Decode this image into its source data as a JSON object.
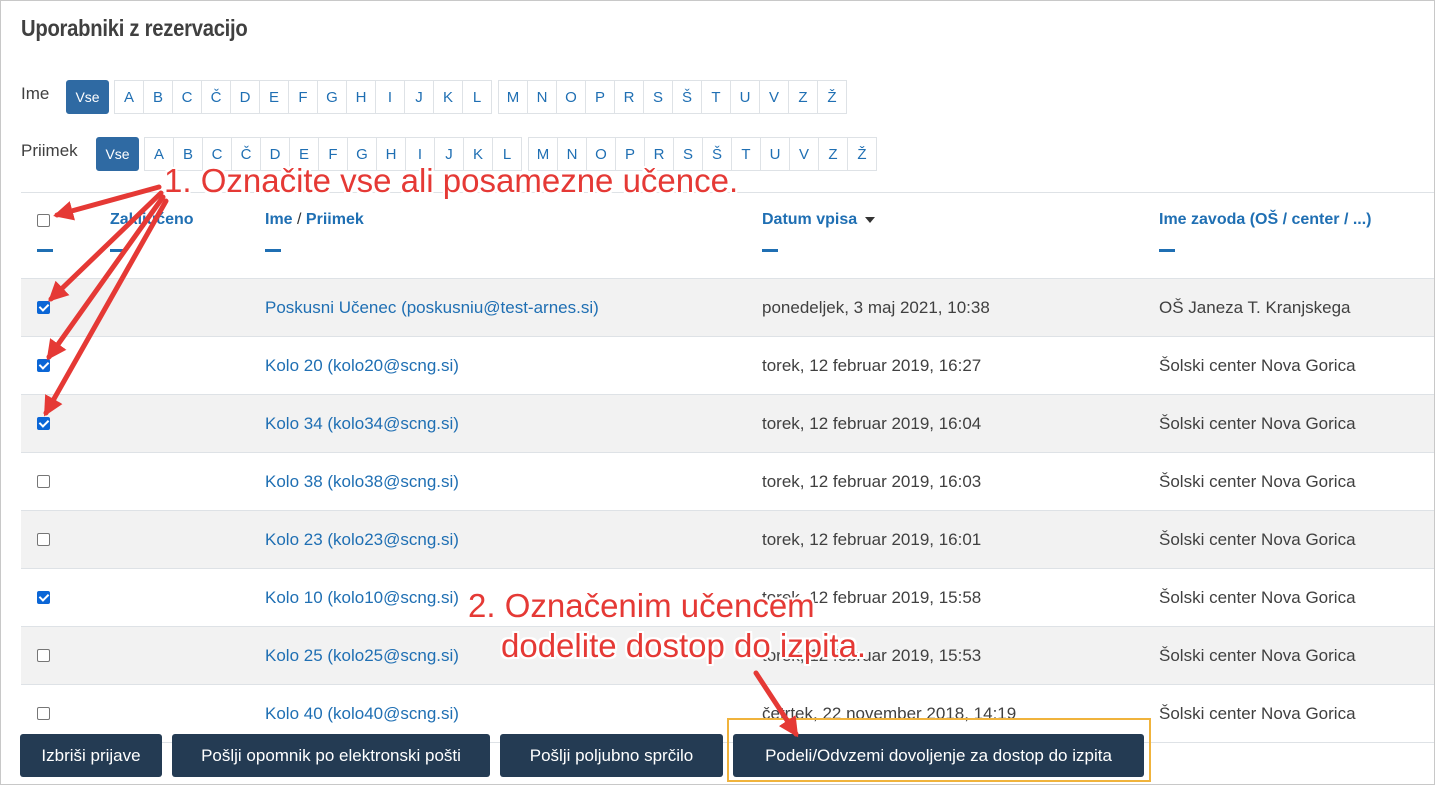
{
  "page": {
    "title": "Uporabniki z rezervacijo"
  },
  "filters": {
    "first_name": {
      "label": "Ime",
      "all": "Vse",
      "letters": [
        [
          "A",
          "B",
          "C",
          "Č",
          "D",
          "E",
          "F",
          "G",
          "H",
          "I",
          "J",
          "K",
          "L"
        ],
        [
          "M",
          "N",
          "O",
          "P",
          "R",
          "S",
          "Š",
          "T",
          "U",
          "V",
          "Z",
          "Ž"
        ]
      ]
    },
    "last_name": {
      "label": "Priimek",
      "all": "Vse",
      "letters": [
        [
          "A",
          "B",
          "C",
          "Č",
          "D",
          "E",
          "F",
          "G",
          "H",
          "I",
          "J",
          "K",
          "L"
        ],
        [
          "M",
          "N",
          "O",
          "P",
          "R",
          "S",
          "Š",
          "T",
          "U",
          "V",
          "Z",
          "Ž"
        ]
      ]
    }
  },
  "table": {
    "headers": {
      "locked": "Zaključeno",
      "first": "Ime",
      "sep": " / ",
      "last": "Priimek",
      "date": "Datum vpisa",
      "institution": "Ime zavoda (OŠ / center / ...)"
    },
    "rows": [
      {
        "checked": true,
        "name": "Poskusni Učenec (poskusniu@test-arnes.si)",
        "date": "ponedeljek, 3 maj 2021, 10:38",
        "institution": "OŠ Janeza T. Kranjskega"
      },
      {
        "checked": true,
        "name": "Kolo 20 (kolo20@scng.si)",
        "date": "torek, 12 februar 2019, 16:27",
        "institution": "Šolski center Nova Gorica"
      },
      {
        "checked": true,
        "name": "Kolo 34 (kolo34@scng.si)",
        "date": "torek, 12 februar 2019, 16:04",
        "institution": "Šolski center Nova Gorica"
      },
      {
        "checked": false,
        "name": "Kolo 38 (kolo38@scng.si)",
        "date": "torek, 12 februar 2019, 16:03",
        "institution": "Šolski center Nova Gorica"
      },
      {
        "checked": false,
        "name": "Kolo 23 (kolo23@scng.si)",
        "date": "torek, 12 februar 2019, 16:01",
        "institution": "Šolski center Nova Gorica"
      },
      {
        "checked": true,
        "name": "Kolo 10 (kolo10@scng.si)",
        "date": "torek, 12 februar 2019, 15:58",
        "institution": "Šolski center Nova Gorica"
      },
      {
        "checked": false,
        "name": "Kolo 25 (kolo25@scng.si)",
        "date": "torek, 12 februar 2019, 15:53",
        "institution": "Šolski center Nova Gorica"
      },
      {
        "checked": false,
        "name": "Kolo 40 (kolo40@scng.si)",
        "date": "četrtek, 22 november 2018, 14:19",
        "institution": "Šolski center Nova Gorica"
      }
    ]
  },
  "actions": {
    "delete": "Izbriši prijave",
    "reminder": "Pošlji opomnik po elektronski pošti",
    "message": "Pošlji poljubno sprčilo",
    "permission": "Podeli/Odvzemi dovoljenje za dostop do izpita"
  },
  "annotations": {
    "step1": "1. Označite vse ali posamezne učence.",
    "step2_line1": "2. Označenim učencem",
    "step2_line2": "dodelite dostop do izpita."
  },
  "colors": {
    "link": "#1f6fb3",
    "button": "#243b53",
    "annotation": "#e53935",
    "highlight": "#f0b33c",
    "checkbox": "#0b66d6"
  }
}
